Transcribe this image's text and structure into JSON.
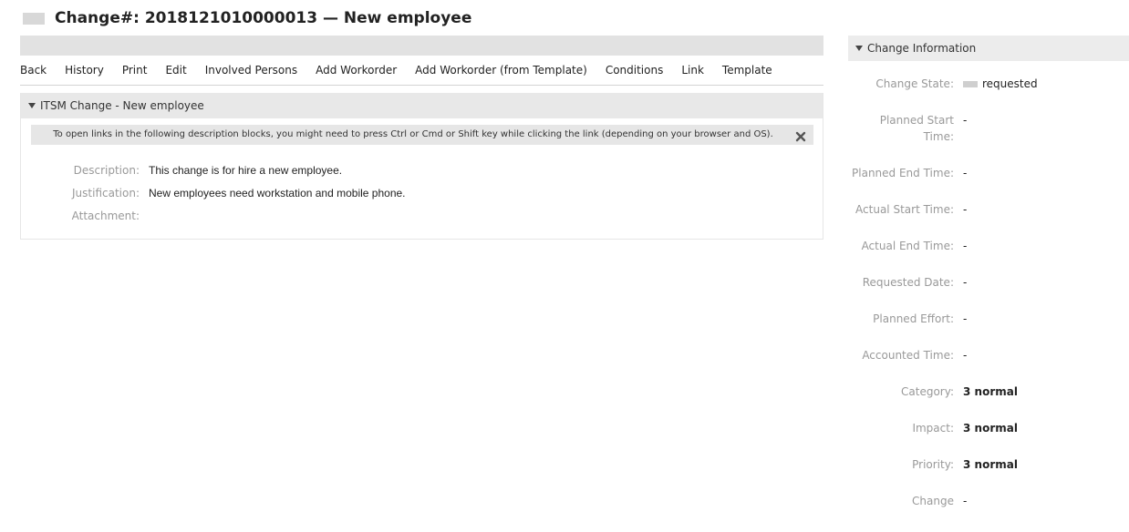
{
  "header": {
    "title": "Change#: 2018121010000013 — New employee"
  },
  "menu": [
    "Back",
    "History",
    "Print",
    "Edit",
    "Involved Persons",
    "Add Workorder",
    "Add Workorder (from Template)",
    "Conditions",
    "Link",
    "Template"
  ],
  "main_widget": {
    "title": "ITSM Change - New employee",
    "notice": "To open links in the following description blocks, you might need to press Ctrl or Cmd or Shift key while clicking the link (depending on your browser and OS).",
    "fields": [
      {
        "label": "Description:",
        "value": "This change is for hire a new employee."
      },
      {
        "label": "Justification:",
        "value": "New employees need workstation and mobile phone."
      },
      {
        "label": "Attachment:",
        "value": ""
      }
    ]
  },
  "side": {
    "title": "Change Information",
    "change_state_label": "Change State:",
    "change_state_value": "requested",
    "planned_start_label": "Planned Start Time:",
    "planned_start_value": "-",
    "planned_end_label": "Planned End Time:",
    "planned_end_value": "-",
    "actual_start_label": "Actual Start Time:",
    "actual_start_value": "-",
    "actual_end_label": "Actual End Time:",
    "actual_end_value": "-",
    "requested_date_label": "Requested Date:",
    "requested_date_value": "-",
    "planned_effort_label": "Planned Effort:",
    "planned_effort_value": "-",
    "accounted_time_label": "Accounted Time:",
    "accounted_time_value": "-",
    "category_label": "Category:",
    "category_value": "3 normal",
    "impact_label": "Impact:",
    "impact_value": "3 normal",
    "priority_label": "Priority:",
    "priority_value": "3 normal",
    "change_label": "Change",
    "change_value": "-"
  }
}
